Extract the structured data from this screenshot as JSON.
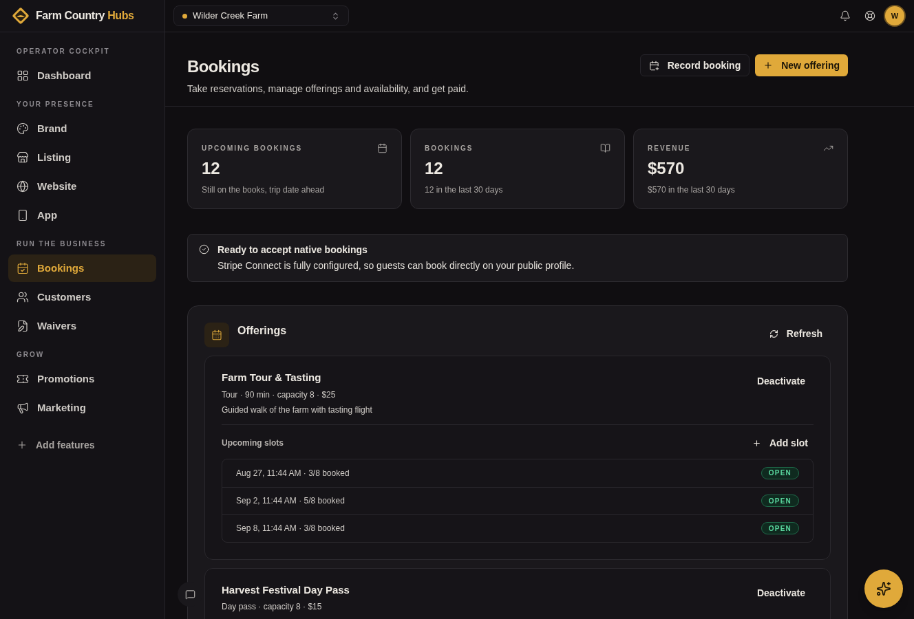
{
  "brand": {
    "name": "Farm Country",
    "accent": "Hubs"
  },
  "farm_switcher": {
    "label": "Wilder Creek Farm",
    "color": "#e0a93a"
  },
  "avatar": {
    "initial": "W"
  },
  "sidebar": {
    "sections": [
      {
        "title": "OPERATOR COCKPIT",
        "items": [
          {
            "label": "Dashboard",
            "selected": false
          }
        ]
      },
      {
        "title": "YOUR PRESENCE",
        "items": [
          {
            "label": "Brand",
            "selected": false
          },
          {
            "label": "Listing",
            "selected": false
          },
          {
            "label": "Website",
            "selected": false
          },
          {
            "label": "App",
            "selected": false
          }
        ]
      },
      {
        "title": "RUN THE BUSINESS",
        "items": [
          {
            "label": "Bookings",
            "selected": true
          },
          {
            "label": "Customers",
            "selected": false
          },
          {
            "label": "Waivers",
            "selected": false
          }
        ]
      },
      {
        "title": "GROW",
        "items": [
          {
            "label": "Promotions",
            "selected": false
          },
          {
            "label": "Marketing",
            "selected": false
          }
        ]
      }
    ],
    "add_features": "Add features"
  },
  "page": {
    "title": "Bookings",
    "subtitle": "Take reservations, manage offerings and availability, and get paid.",
    "buttons": [
      {
        "label": "Record booking",
        "kind": "secondary"
      },
      {
        "label": "New offering",
        "kind": "primary"
      }
    ]
  },
  "stats": [
    {
      "label": "UPCOMING BOOKINGS",
      "value": "12",
      "note": "Still on the books, trip date ahead"
    },
    {
      "label": "BOOKINGS",
      "value": "12",
      "note": "12 in the last 30 days"
    },
    {
      "label": "REVENUE",
      "value": "$570",
      "note": "$570 in the last 30 days"
    }
  ],
  "notice": {
    "title": "Ready to accept native bookings",
    "text": "Stripe Connect is fully configured, so guests can book directly on your public profile."
  },
  "offerings": {
    "title": "Offerings",
    "refresh": "Refresh",
    "items": [
      {
        "name": "Farm Tour & Tasting",
        "meta": "Tour · 90 min · capacity 8 · $25",
        "description": "Guided walk of the farm with tasting flight",
        "action": "Deactivate",
        "slots_title": "Upcoming slots",
        "add_slot": "Add slot",
        "slots": [
          {
            "text": "Aug 27, 11:44 AM · 3/8 booked",
            "status": "OPEN"
          },
          {
            "text": "Sep 2, 11:44 AM · 5/8 booked",
            "status": "OPEN"
          },
          {
            "text": "Sep 8, 11:44 AM · 3/8 booked",
            "status": "OPEN"
          }
        ]
      },
      {
        "name": "Harvest Festival Day Pass",
        "meta": "Day pass · capacity 8 · $15",
        "action": "Deactivate"
      }
    ]
  }
}
